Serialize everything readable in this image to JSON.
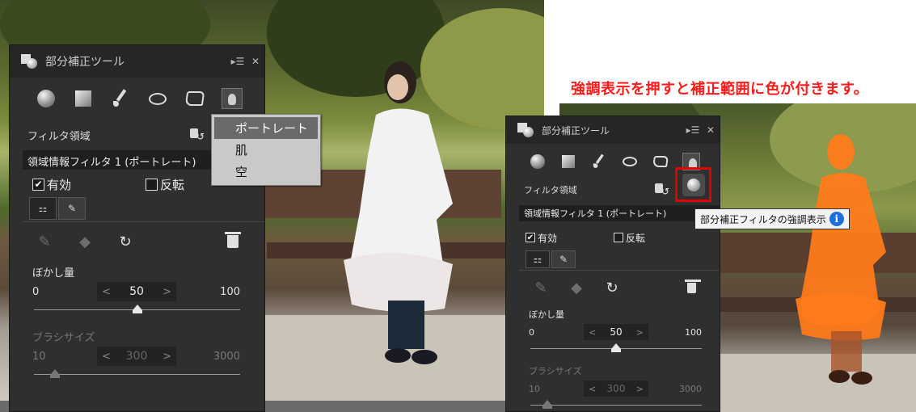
{
  "caption": "強調表示を押すと補正範囲に色が付きます。",
  "panel": {
    "title": "部分補正ツール",
    "window_controls": [
      "▸☰",
      "✕"
    ],
    "tools": [
      "circle-tool",
      "square-tool",
      "brush-tool",
      "ellipse-tool",
      "polygon-tool",
      "portrait-tool"
    ],
    "filter_area_label": "フィルタ領域",
    "filter_name": "領域情報フィルタ 1 (ポートレート)",
    "enabled_label": "有効",
    "enabled_checked": "✔",
    "invert_label": "反転",
    "subtabs": [
      "⚏",
      "✎"
    ],
    "blur": {
      "label": "ぼかし量",
      "min": "0",
      "value": "50",
      "max": "100",
      "position_fraction": 0.5
    },
    "brush_size": {
      "label": "ブラシサイズ",
      "min": "10",
      "value": "300",
      "max": "3000",
      "position_fraction": 0.1
    },
    "spin_left": "<",
    "spin_right": ">"
  },
  "dropdown": {
    "items": [
      "ポートレート",
      "肌",
      "空"
    ],
    "selected_index": 0
  },
  "tooltip": {
    "text": "部分補正フィルタの強調表示"
  },
  "colors": {
    "highlight_overlay": "#ff7a1a",
    "annotation_red": "#e00000",
    "panel_bg": "#2f2f2f"
  }
}
